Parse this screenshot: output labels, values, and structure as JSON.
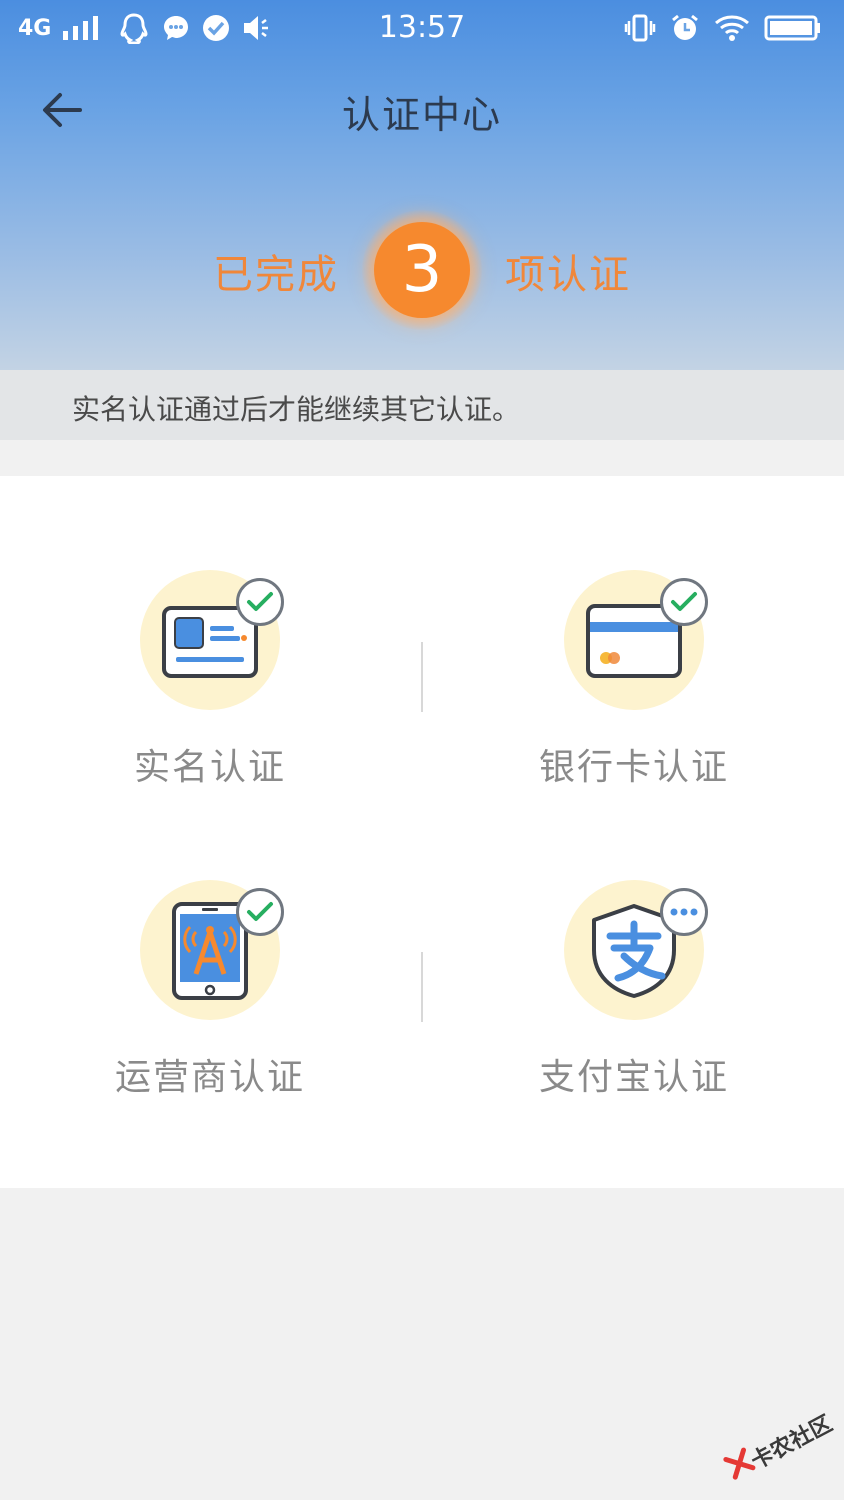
{
  "status_bar": {
    "network": "4G",
    "time": "13:57"
  },
  "nav": {
    "title": "认证中心"
  },
  "progress": {
    "prefix": "已完成",
    "count": "3",
    "suffix": "项认证"
  },
  "notice": "实名认证通过后才能继续其它认证。",
  "items": [
    {
      "label": "实名认证",
      "icon": "id-card-icon",
      "status": "verified"
    },
    {
      "label": "银行卡认证",
      "icon": "bank-card-icon",
      "status": "verified"
    },
    {
      "label": "运营商认证",
      "icon": "carrier-phone-icon",
      "status": "verified"
    },
    {
      "label": "支付宝认证",
      "icon": "alipay-shield-icon",
      "status": "pending"
    }
  ],
  "watermark": "卡农社区",
  "colors": {
    "header_top": "#4b8ee0",
    "accent_orange": "#f6892e",
    "check_green": "#27ae60",
    "card_blue": "#4a8fe0"
  }
}
